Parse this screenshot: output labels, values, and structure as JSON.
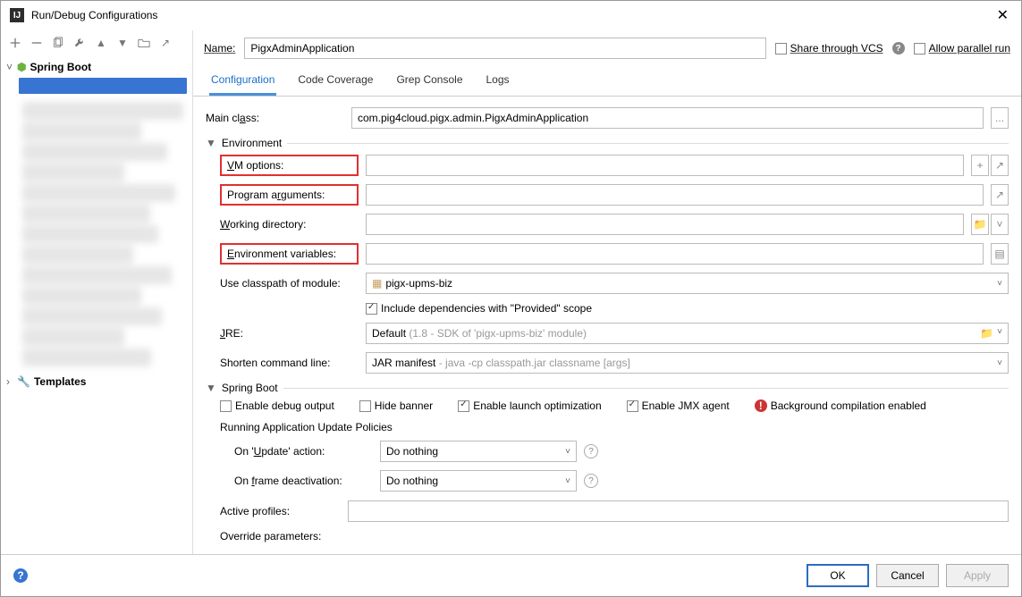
{
  "window": {
    "title": "Run/Debug Configurations"
  },
  "tree": {
    "spring_boot": "Spring Boot",
    "templates": "Templates"
  },
  "name_row": {
    "label": "Name:",
    "value": "PigxAdminApplication",
    "share_vcs": "Share through VCS",
    "allow_parallel": "Allow parallel run"
  },
  "tabs": {
    "configuration": "Configuration",
    "code_coverage": "Code Coverage",
    "grep_console": "Grep Console",
    "logs": "Logs"
  },
  "form": {
    "main_class_label": "Main class:",
    "main_class_value": "com.pig4cloud.pigx.admin.PigxAdminApplication",
    "env_section": "Environment",
    "vm_options": "VM options:",
    "program_args": "Program arguments:",
    "working_dir": "Working directory:",
    "env_vars": "Environment variables:",
    "use_classpath": "Use classpath of module:",
    "classpath_value": "pigx-upms-biz",
    "include_deps": "Include dependencies with \"Provided\" scope",
    "jre": "JRE:",
    "jre_value_prefix": "Default",
    "jre_value_hint": " (1.8 - SDK of 'pigx-upms-biz' module)",
    "shorten": "Shorten command line:",
    "shorten_value_prefix": "JAR manifest",
    "shorten_value_hint": " - java -cp classpath.jar classname [args]",
    "spring_section": "Spring Boot",
    "enable_debug": "Enable debug output",
    "hide_banner": "Hide banner",
    "enable_launch": "Enable launch optimization",
    "enable_jmx": "Enable JMX agent",
    "bg_comp": "Background compilation enabled",
    "policies": "Running Application Update Policies",
    "on_update": "On 'Update' action:",
    "on_frame": "On frame deactivation:",
    "do_nothing": "Do nothing",
    "active_profiles": "Active profiles:",
    "override_params": "Override parameters:"
  },
  "footer": {
    "ok": "OK",
    "cancel": "Cancel",
    "apply": "Apply"
  }
}
